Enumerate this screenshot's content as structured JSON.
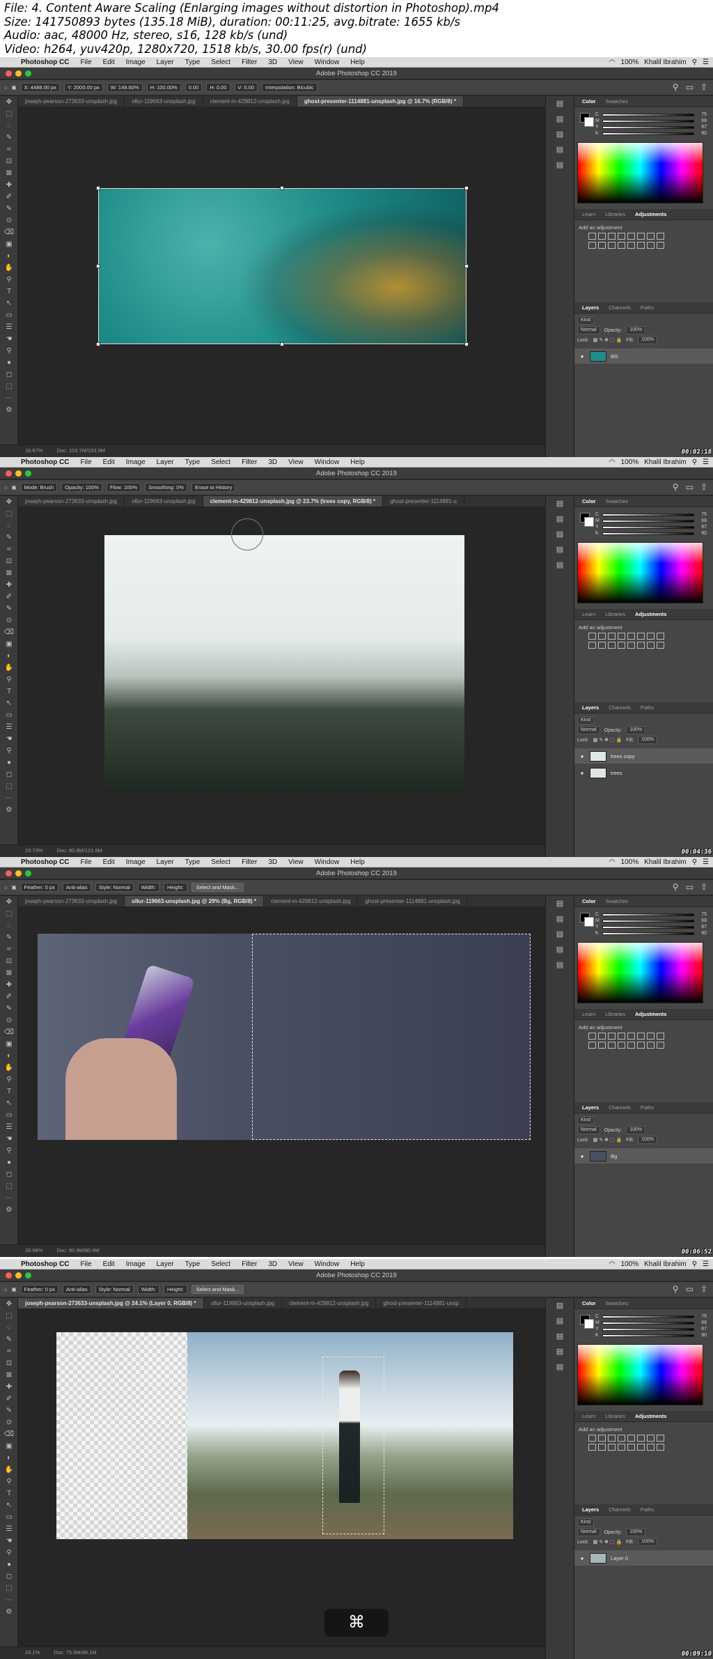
{
  "header": {
    "lines": [
      "File: 4. Content Aware Scaling (Enlarging images without distortion in Photoshop).mp4",
      "Size: 141750893 bytes (135.18 MiB), duration: 00:11:25, avg.bitrate: 1655 kb/s",
      "Audio: aac, 48000 Hz, stereo, s16, 128 kb/s (und)",
      "Video: h264, yuv420p, 1280x720, 1518 kb/s, 30.00 fps(r) (und)"
    ]
  },
  "mac_menu": {
    "app": "Photoshop CC",
    "items": [
      "File",
      "Edit",
      "Image",
      "Layer",
      "Type",
      "Select",
      "Filter",
      "3D",
      "View",
      "Window",
      "Help"
    ],
    "battery": "100%",
    "user": "Khalil Ibrahim"
  },
  "window_title": "Adobe Photoshop CC 2019",
  "panel_tabs": {
    "color": [
      "Color",
      "Swatches"
    ],
    "adjust": [
      "Learn",
      "Libraries",
      "Adjustments"
    ],
    "layers": [
      "Layers",
      "Channels",
      "Paths"
    ]
  },
  "adjust_label": "Add an adjustment",
  "color_sliders": [
    {
      "label": "C",
      "value": "75"
    },
    {
      "label": "M",
      "value": "68"
    },
    {
      "label": "Y",
      "value": "67"
    },
    {
      "label": "K",
      "value": "90"
    }
  ],
  "layer_controls": {
    "kind": "Kind",
    "blend": "Normal",
    "opacity_label": "Opacity:",
    "opacity": "100%",
    "lock": "Lock:",
    "fill_label": "Fill:",
    "fill": "100%"
  },
  "frames": [
    {
      "tabs": [
        "joseph-pearson-273633-unsplash.jpg",
        "ollur-119663-unsplash.jpg",
        "clement-m-429812-unsplash.jpg",
        "ghost-presenter-1114881-unsplash.jpg @ 16.7% (RGB/8) *"
      ],
      "active_tab": 3,
      "options": [
        "X: 4488.00 px",
        "Y: 2000.00 px",
        "W: 149.60%",
        "H: 100.00%",
        "0.00",
        "H: 0.00",
        "V: 0.00",
        "Interpolation: Bicubic"
      ],
      "status": {
        "zoom": "16.67%",
        "doc": "Doc: 103.7M/103.9M"
      },
      "layers": [
        {
          "name": "BG",
          "selected": true
        }
      ],
      "timestamp": "00:02:18"
    },
    {
      "tabs": [
        "joseph-pearson-273633-unsplash.jpg",
        "ollur-119663-unsplash.jpg",
        "clement-m-429812-unsplash.jpg @ 23.7% (trees copy, RGB/8) *",
        "ghost-presenter-1114881-u"
      ],
      "active_tab": 2,
      "options": [
        "Mode: Brush",
        "Opacity: 100%",
        "Flow: 100%",
        "Smoothing: 0%",
        "Erase to History"
      ],
      "status": {
        "zoom": "23.73%",
        "doc": "Doc: 80.8M/121.6M"
      },
      "layers": [
        {
          "name": "trees copy",
          "selected": true
        },
        {
          "name": "trees",
          "selected": false
        }
      ],
      "timestamp": "00:04:36"
    },
    {
      "tabs": [
        "joseph-pearson-273633-unsplash.jpg",
        "ollur-119663-unsplash.jpg @ 29% (Bg, RGB/8) *",
        "clement-m-429812-unsplash.jpg",
        "ghost-presenter-1114881-unsplash.jpg"
      ],
      "active_tab": 1,
      "options": [
        "Feather: 0 px",
        "Anti-alias",
        "Style: Normal",
        "Width:",
        "Height:",
        "Select and Mask..."
      ],
      "status": {
        "zoom": "28.98%",
        "doc": "Doc: 80.9M/80.9M"
      },
      "layers": [
        {
          "name": "Bg",
          "selected": true
        }
      ],
      "timestamp": "00:06:52"
    },
    {
      "tabs": [
        "joseph-pearson-273633-unsplash.jpg @ 24.1% (Layer 0, RGB/8) *",
        "ollur-119663-unsplash.jpg",
        "clement-m-429812-unsplash.jpg",
        "ghost-presenter-1114881-unsp"
      ],
      "active_tab": 0,
      "options": [
        "Feather: 0 px",
        "Anti-alias",
        "Style: Normal",
        "Width:",
        "Height:",
        "Select and Mask..."
      ],
      "status": {
        "zoom": "24.1%",
        "doc": "Doc: 75.9M/88.1M"
      },
      "layers": [
        {
          "name": "Layer 0",
          "selected": true
        }
      ],
      "timestamp": "00:09:10",
      "overlay_key": "⌘"
    }
  ]
}
